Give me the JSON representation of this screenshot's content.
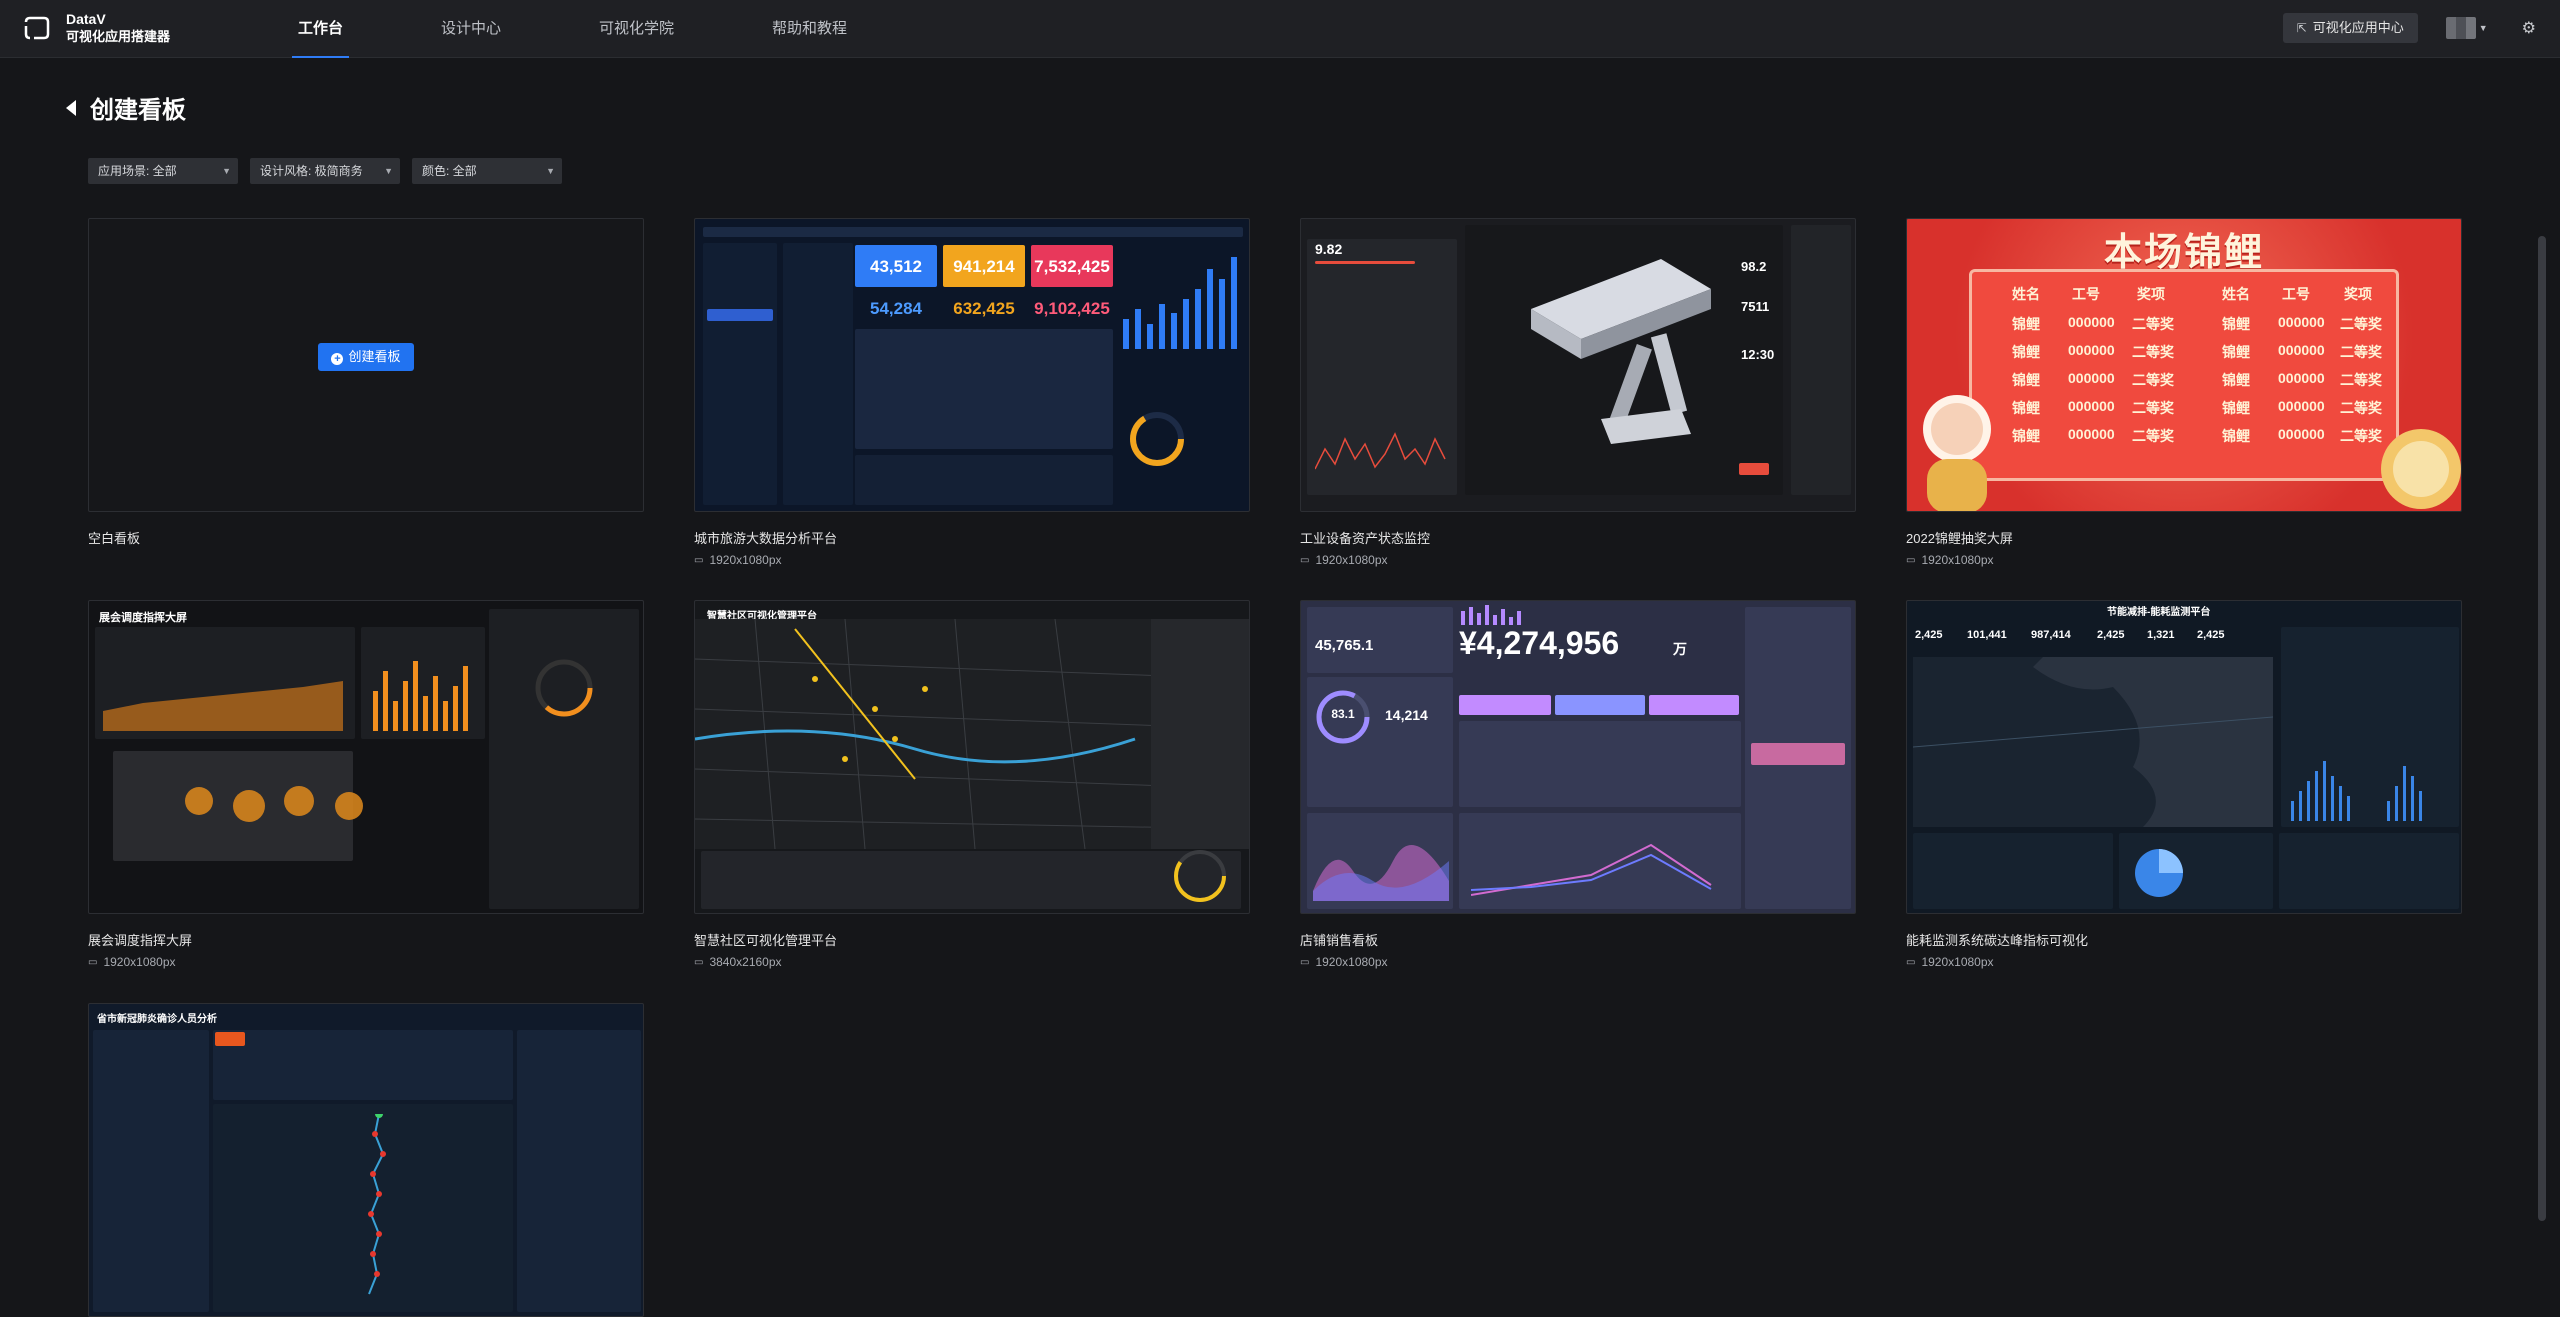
{
  "brand": {
    "name": "DataV",
    "subtitle": "可视化应用搭建器"
  },
  "nav": {
    "tabs": [
      {
        "label": "工作台",
        "active": true
      },
      {
        "label": "设计中心",
        "active": false
      },
      {
        "label": "可视化学院",
        "active": false
      },
      {
        "label": "帮助和教程",
        "active": false
      }
    ],
    "app_center_label": "可视化应用中心"
  },
  "page": {
    "title": "创建看板"
  },
  "filters": [
    {
      "label": "应用场景:  全部"
    },
    {
      "label": "设计风格:  极简商务"
    },
    {
      "label": "颜色:  全部"
    }
  ],
  "blank_card": {
    "name": "空白看板",
    "create_label": "创建看板"
  },
  "templates": [
    {
      "name": "城市旅游大数据分析平台",
      "size": "1920x1080px"
    },
    {
      "name": "工业设备资产状态监控",
      "size": "1920x1080px"
    },
    {
      "name": "2022锦鲤抽奖大屏",
      "size": "1920x1080px"
    },
    {
      "name": "展会调度指挥大屏",
      "size": "1920x1080px"
    },
    {
      "name": "智慧社区可视化管理平台",
      "size": "3840x2160px"
    },
    {
      "name": "店铺销售看板",
      "size": "1920x1080px"
    },
    {
      "name": "能耗监测系统碳达峰指标可视化",
      "size": "1920x1080px"
    }
  ],
  "thumb_text": {
    "city_kpis": [
      "43,512",
      "941,214",
      "7,532,425",
      "54,284",
      "632,425",
      "9,102,425"
    ],
    "lottery_title": "本场锦鲤",
    "lottery_headers": [
      "姓名",
      "工号",
      "奖项"
    ],
    "lottery_row": [
      "锦鲤",
      "000000",
      "二等奖"
    ],
    "sales_total": "¥4,274,956",
    "sales_unit": "万",
    "sales_left": "45,765.1",
    "sales_mid": "14,214",
    "sales_pct": "83.1",
    "expo_title": "展会调度指挥大屏",
    "community_title": "智慧社区可视化管理平台",
    "energy_title": "节能减排-能耗监测平台",
    "energy_kpis": [
      "2,425",
      "101,441",
      "987,414",
      "2,425",
      "1,321",
      "2,425"
    ],
    "ops_title": "省市新冠肺炎确诊人员分析",
    "industrial_title": "工业设备资产状态监控",
    "industrial_vals": [
      "9.82",
      "98.2",
      "7511",
      "12:30"
    ]
  },
  "colors": {
    "accent": "#2f7cf6",
    "create_btn": "#2173f1",
    "bg": "#151619",
    "nav_bg": "#1f2024"
  }
}
